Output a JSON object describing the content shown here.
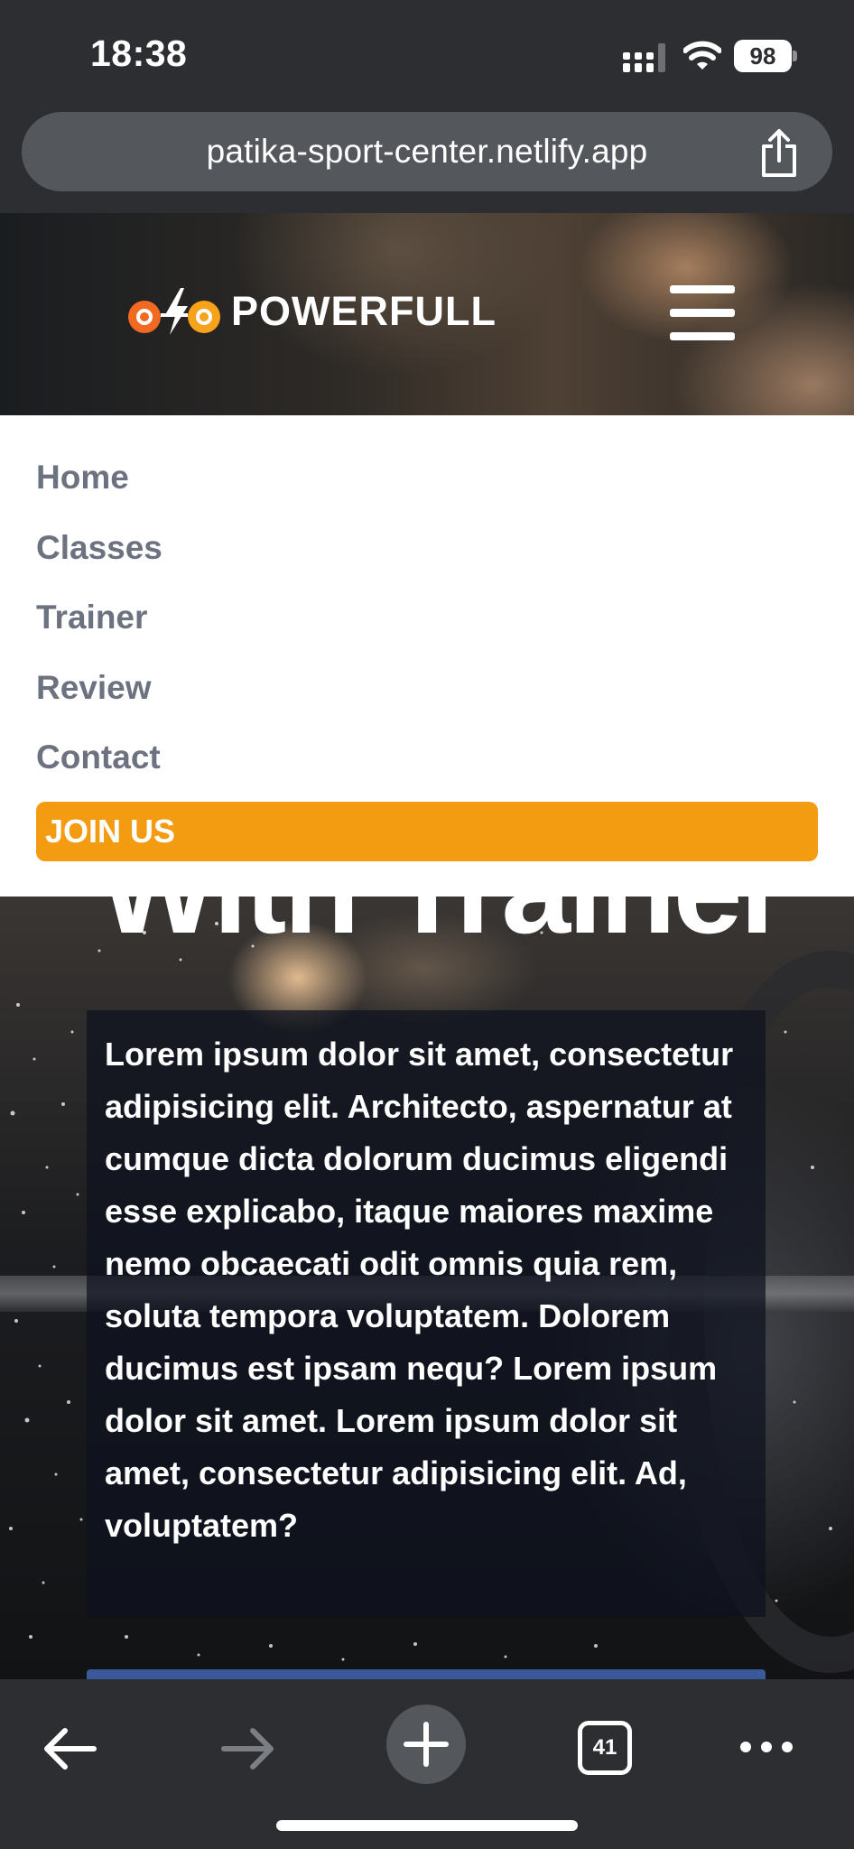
{
  "status_bar": {
    "time": "18:38",
    "battery": "98",
    "signal_icon": "cellular-signal-icon",
    "wifi_icon": "wifi-icon"
  },
  "browser": {
    "url": "patika-sport-center.netlify.app",
    "share_icon": "share-icon"
  },
  "header": {
    "logo_text": "POWERFULL",
    "logo_colors": [
      "#f26a21",
      "#f7a21b"
    ],
    "menu_icon": "hamburger-menu-icon"
  },
  "nav": {
    "items": [
      {
        "label": "Home"
      },
      {
        "label": "Classes"
      },
      {
        "label": "Trainer"
      },
      {
        "label": "Review"
      },
      {
        "label": "Contact"
      }
    ],
    "join_label": "JOIN US",
    "join_color": "#f39c12",
    "item_color": "#6c727f"
  },
  "hero": {
    "title_fragment": "With Trainer",
    "description": "Lorem ipsum dolor sit amet, consectetur adipisicing elit. Architecto, aspernatur at cumque dicta dolorum ducimus eligendi esse explicabo, itaque maiores maxime nemo obcaecati odit omnis quia rem, soluta tempora voluptatem. Dolorem ducimus est ipsam nequ? Lorem ipsum dolor sit amet. Lorem ipsum dolor sit amet, consectetur adipisicing elit. Ad, voluptatem?"
  },
  "toolbar": {
    "back_icon": "back-arrow-icon",
    "forward_icon": "forward-arrow-icon",
    "new_tab_icon": "plus-icon",
    "tab_count": "41",
    "more_icon": "more-dots-icon"
  }
}
